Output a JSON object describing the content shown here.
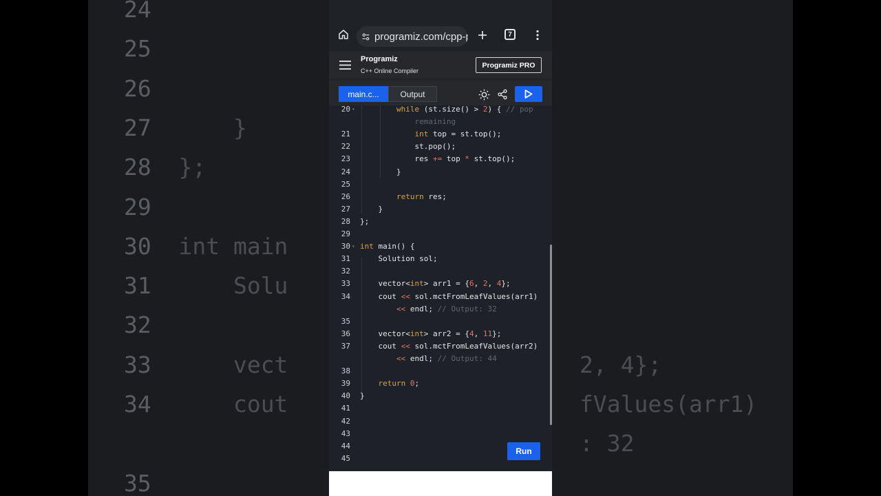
{
  "background_code": {
    "left": [
      {
        "num": "24",
        "text": ""
      },
      {
        "num": "25",
        "text": ""
      },
      {
        "num": "26",
        "text": ""
      },
      {
        "num": "27",
        "text": "    }"
      },
      {
        "num": "28",
        "text": "};"
      },
      {
        "num": "29",
        "text": ""
      },
      {
        "num": "30",
        "text": "int main"
      },
      {
        "num": "31",
        "text": "    Solu"
      },
      {
        "num": "32",
        "text": ""
      },
      {
        "num": "33",
        "text": "    vect"
      },
      {
        "num": "34",
        "text": "    cout"
      },
      {
        "num": "",
        "text": ""
      },
      {
        "num": "35",
        "text": ""
      }
    ],
    "right": [
      {
        "text": "2, 4};",
        "row": 9
      },
      {
        "text": "fValues(arr1)",
        "row": 10
      },
      {
        "text": ": 32",
        "row": 11
      }
    ]
  },
  "browser": {
    "url": "programiz.com/cpp-p",
    "tab_count": "7"
  },
  "app": {
    "logo": "Programiz",
    "subtitle": "C++ Online Compiler",
    "pro_button": "Programiz PRO",
    "tab_main": "main.c...",
    "tab_output": "Output",
    "run_button": "Run"
  },
  "code_lines": [
    {
      "num": "20",
      "html": "        <span class='kw'>while</span> (st.size() > <span class='num'>2</span>) { <span class='cm'>// pop</span>",
      "fold": true
    },
    {
      "num": "",
      "html": "            <span class='cm'>remaining</span>"
    },
    {
      "num": "21",
      "html": "            <span class='kw'>int</span> top = st.top();"
    },
    {
      "num": "22",
      "html": "            st.pop();"
    },
    {
      "num": "23",
      "html": "            res <span class='num'>+=</span> top <span class='num'>*</span> st.top();"
    },
    {
      "num": "24",
      "html": "        }"
    },
    {
      "num": "25",
      "html": ""
    },
    {
      "num": "26",
      "html": "        <span class='kw'>return</span> res;"
    },
    {
      "num": "27",
      "html": "    }"
    },
    {
      "num": "28",
      "html": "};"
    },
    {
      "num": "29",
      "html": ""
    },
    {
      "num": "30",
      "html": "<span class='kw'>int</span> main() {",
      "fold": true
    },
    {
      "num": "31",
      "html": "    Solution sol;"
    },
    {
      "num": "32",
      "html": ""
    },
    {
      "num": "33",
      "html": "    vector<<span class='kw'>int</span>> arr1 = {<span class='num'>6</span>, <span class='num'>2</span>, <span class='num'>4</span>};"
    },
    {
      "num": "34",
      "html": "    cout <span class='num'><<</span> sol.mctFromLeafValues(arr1)"
    },
    {
      "num": "",
      "html": "        <span class='num'><<</span> endl; <span class='cm'>// Output: 32</span>"
    },
    {
      "num": "35",
      "html": ""
    },
    {
      "num": "36",
      "html": "    vector<<span class='kw'>int</span>> arr2 = {<span class='num'>4</span>, <span class='num'>11</span>};"
    },
    {
      "num": "37",
      "html": "    cout <span class='num'><<</span> sol.mctFromLeafValues(arr2)"
    },
    {
      "num": "",
      "html": "        <span class='num'><<</span> endl; <span class='cm'>// Output: 44</span>"
    },
    {
      "num": "38",
      "html": ""
    },
    {
      "num": "39",
      "html": "    <span class='kw'>return</span> <span class='num'>0</span>;"
    },
    {
      "num": "40",
      "html": "}"
    },
    {
      "num": "41",
      "html": ""
    },
    {
      "num": "42",
      "html": ""
    },
    {
      "num": "43",
      "html": ""
    },
    {
      "num": "44",
      "html": ""
    },
    {
      "num": "45",
      "html": ""
    }
  ],
  "icons": {
    "home": "home-icon",
    "site_settings": "site-settings-icon",
    "new_tab": "plus-icon",
    "tabs": "tabs-icon",
    "menu": "more-vert-icon",
    "hamburger": "hamburger-icon",
    "theme": "sun-icon",
    "share": "share-icon",
    "run": "play-icon"
  },
  "colors": {
    "accent": "#1a62ee",
    "keyword": "#d4a44b",
    "number": "#e0766a",
    "comment": "#5f6670"
  }
}
